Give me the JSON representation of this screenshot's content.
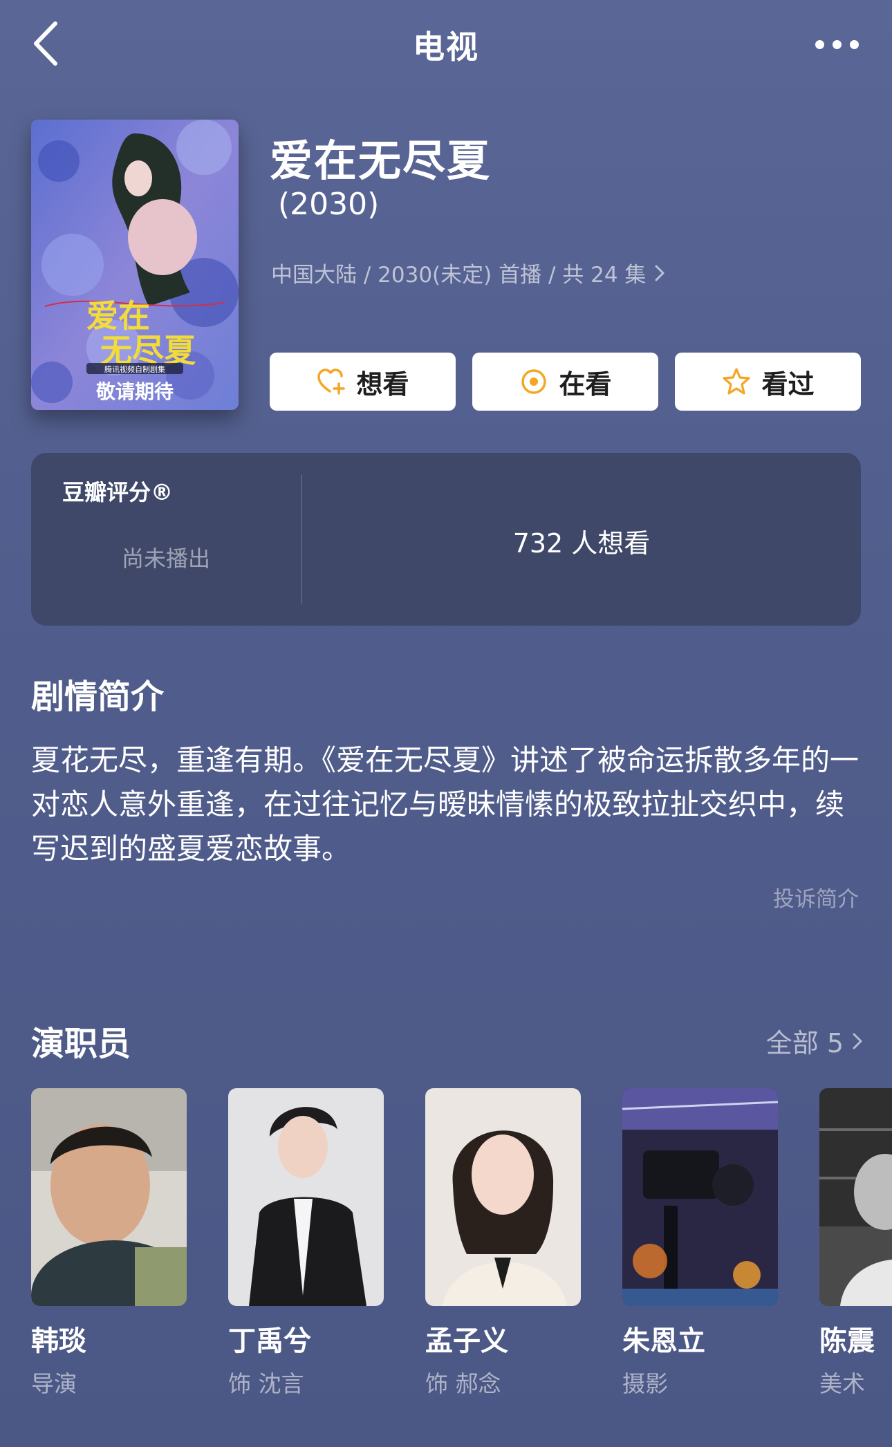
{
  "nav": {
    "title": "电视"
  },
  "movie": {
    "title": "爱在无尽夏",
    "year": "(2030)",
    "meta": "中国大陆 / 2030(未定) 首播 / 共 24 集",
    "poster": {
      "title_art": "爱在无尽夏",
      "subtitle": "腾讯视频自制剧集",
      "tagline": "敬请期待"
    }
  },
  "actions": [
    {
      "label": "想看",
      "icon": "heart-plus-icon",
      "color": "#f5a623"
    },
    {
      "label": "在看",
      "icon": "target-circle-icon",
      "color": "#f5a623"
    },
    {
      "label": "看过",
      "icon": "star-icon",
      "color": "#f5a623"
    }
  ],
  "rating": {
    "label": "豆瓣评分®",
    "status": "尚未播出",
    "want_count": "732 人想看"
  },
  "synopsis": {
    "title": "剧情简介",
    "text": "夏花无尽，重逢有期。《爱在无尽夏》讲述了被命运拆散多年的一对恋人意外重逢，在过往记忆与暧昧情愫的极致拉扯交织中，续写迟到的盛夏爱恋故事。",
    "report": "投诉简介"
  },
  "cast": {
    "title": "演职员",
    "all_label": "全部 5",
    "members": [
      {
        "name": "韩琰",
        "role": "导演"
      },
      {
        "name": "丁禹兮",
        "role": "饰 沈言"
      },
      {
        "name": "孟子义",
        "role": "饰 郝念"
      },
      {
        "name": "朱恩立",
        "role": "摄影"
      },
      {
        "name": "陈震",
        "role": "美术"
      }
    ]
  },
  "colors": {
    "background": "#54608f",
    "card": "#3f4868",
    "accent": "#f5a623"
  }
}
